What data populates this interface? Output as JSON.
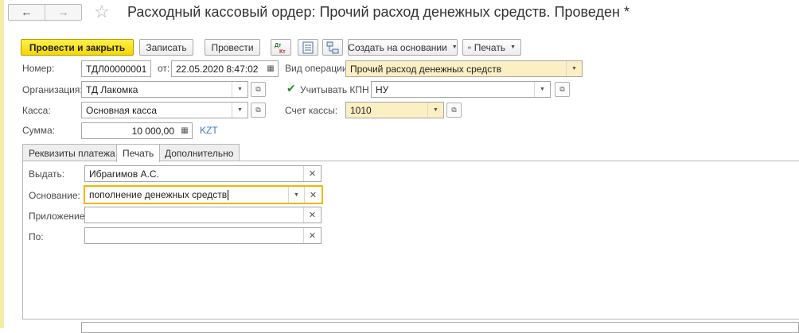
{
  "window": {
    "title": "Расходный кассовый ордер: Прочий расход денежных средств. Проведен *",
    "back_icon": "←",
    "forward_icon": "→",
    "star_icon": "☆"
  },
  "toolbar": {
    "post_close_label": "Провести и закрыть",
    "save_label": "Записать",
    "post_label": "Провести",
    "dtkt_label": "Дт Кт",
    "create_based_label": "Создать на основании",
    "print_label": "Печать"
  },
  "form": {
    "number_label": "Номер:",
    "number_value": "ТДЛ00000001",
    "date_label": "от:",
    "date_value": "22.05.2020  8:47:02",
    "operation_label": "Вид операции:",
    "operation_value": "Прочий расход денежных средств",
    "org_label": "Организация:",
    "org_value": "ТД Лакомка",
    "kpn_label": "Учитывать КПН",
    "kpn_value": "НУ",
    "cash_label": "Касса:",
    "cash_value": "Основная касса",
    "cash_account_label": "Счет кассы:",
    "cash_account_value": "1010",
    "sum_label": "Сумма:",
    "sum_value": "10 000,00",
    "currency": "KZT"
  },
  "tabs": [
    {
      "label": "Реквизиты платежа"
    },
    {
      "label": "Печать"
    },
    {
      "label": "Дополнительно"
    }
  ],
  "print_tab": {
    "issue_label": "Выдать:",
    "issue_value": "Ибрагимов А.С.",
    "basis_label": "Основание:",
    "basis_value": "пополнение денежных средств",
    "attachment_label": "Приложение:",
    "attachment_value": "",
    "by_label": "По:",
    "by_value": ""
  },
  "colors": {
    "primary_button": "#f5d600",
    "required_field": "#fbefc3",
    "focus_border": "#f0b800",
    "currency_link": "#3a78b8"
  }
}
